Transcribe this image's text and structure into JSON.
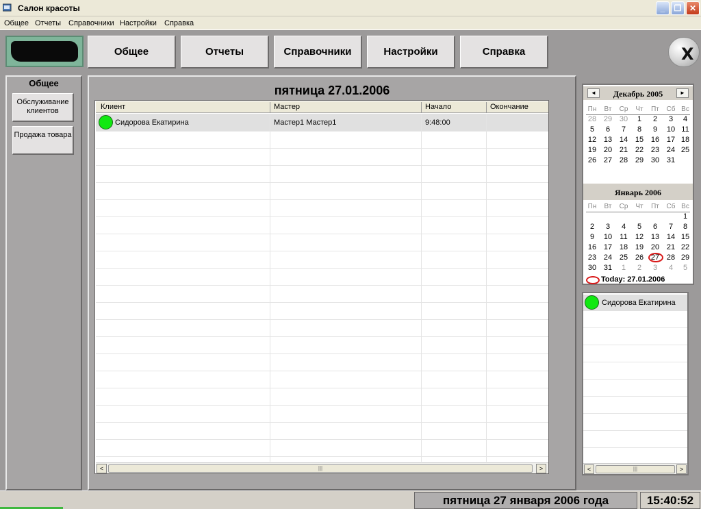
{
  "window": {
    "title": "Салон красоты"
  },
  "menu": [
    "Общее",
    "Отчеты",
    "Справочники",
    "Настройки",
    "Справка"
  ],
  "toolbar": {
    "buttons": [
      "Общее",
      "Отчеты",
      "Справочники",
      "Настройки",
      "Справка"
    ],
    "exit_label": "X"
  },
  "left_panel": {
    "title": "Общее",
    "buttons": [
      "Обслуживание клиентов",
      "Продажа товара"
    ]
  },
  "schedule": {
    "date_title": "пятница 27.01.2006",
    "columns": [
      "Клиент",
      "Мастер",
      "Начало",
      "Окончание"
    ],
    "rows": [
      {
        "client": "Сидорова Екатирина",
        "master": "Мастер1 Мастер1",
        "start": "9:48:00",
        "end": "",
        "status_color": "#11e811"
      }
    ]
  },
  "calendar": {
    "weekdays": [
      "Пн",
      "Вт",
      "Ср",
      "Чт",
      "Пт",
      "Сб",
      "Вс"
    ],
    "month1": {
      "title": "Декабрь 2005",
      "weeks": [
        [
          "28",
          "29",
          "30",
          "1",
          "2",
          "3",
          "4"
        ],
        [
          "5",
          "6",
          "7",
          "8",
          "9",
          "10",
          "11"
        ],
        [
          "12",
          "13",
          "14",
          "15",
          "16",
          "17",
          "18"
        ],
        [
          "19",
          "20",
          "21",
          "22",
          "23",
          "24",
          "25"
        ],
        [
          "26",
          "27",
          "28",
          "29",
          "30",
          "31",
          ""
        ]
      ]
    },
    "month2": {
      "title": "Январь 2006",
      "weeks": [
        [
          "",
          "",
          "",
          "",
          "",
          "",
          "1"
        ],
        [
          "2",
          "3",
          "4",
          "5",
          "6",
          "7",
          "8"
        ],
        [
          "9",
          "10",
          "11",
          "12",
          "13",
          "14",
          "15"
        ],
        [
          "16",
          "17",
          "18",
          "19",
          "20",
          "21",
          "22"
        ],
        [
          "23",
          "24",
          "25",
          "26",
          "27",
          "28",
          "29"
        ],
        [
          "30",
          "31",
          "1",
          "2",
          "3",
          "4",
          "5"
        ]
      ]
    },
    "selected_day": "27",
    "today_label": "Today: 27.01.2006",
    "nav_prev": "◄",
    "nav_next": "►"
  },
  "client_list": [
    {
      "name": "Сидорова Екатирина",
      "status_color": "#11e811"
    }
  ],
  "status": {
    "date": "пятница 27 января 2006 года",
    "time": "15:40:52"
  },
  "scroll": {
    "left": "<",
    "right": ">",
    "grip": "|||"
  }
}
